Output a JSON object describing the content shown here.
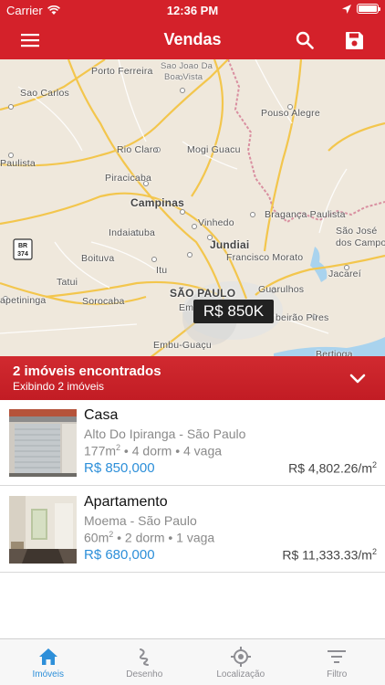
{
  "status_bar": {
    "carrier": "Carrier",
    "time": "12:36 PM",
    "battery_level": 0.9
  },
  "nav": {
    "title": "Vendas",
    "menu_icon": "hamburger-icon",
    "search_icon": "search-icon",
    "save_icon": "floppy-disk-icon"
  },
  "map": {
    "labels": {
      "porto_ferreira": "Porto Ferreira",
      "sao_joao": "Sao Joao Da",
      "boa_vista": "Boa Vista",
      "sao_carlos": "Sao Carlos",
      "pouso_alegre": "Pouso Alegre",
      "rio_claro": "Rio Claro",
      "mogi_guacu": "Mogi Guacu",
      "paulista": "Paulista",
      "piracicaba": "Piracicaba",
      "campinas": "Campinas",
      "vinhedo": "Vinhedo",
      "braganca": "Bragança Paulista",
      "sao_jose": "São José",
      "dos_campos": "dos Campo",
      "indaiatuba": "Indaiatuba",
      "jundiai": "Jundiai",
      "itu": "Itu",
      "francisco_morato": "Francisco Morato",
      "jacarei": "Jacareí",
      "tatui": "Tatui",
      "boituva": "Boituva",
      "sorocaba": "Sorocaba",
      "sao_paulo": "SÃO PAULO",
      "guarulhos": "Guarulhos",
      "apetininga": "apetininga",
      "embu": "Em",
      "ribeirao_pires": "beirão Pires",
      "embu_guacu": "Embu-Guaçu",
      "bertioga": "Bertioga",
      "shield_top": "BR",
      "shield_bottom": "374"
    },
    "price_marker": "R$ 850K"
  },
  "results": {
    "title": "2 imóveis encontrados",
    "subtitle": "Exibindo 2 imóveis",
    "chevron_icon": "chevron-down-icon"
  },
  "listings": [
    {
      "title": "Casa",
      "location": "Alto Do Ipiranga - São Paulo",
      "area": "177m",
      "area_sup": "2",
      "rooms": " • 4 dorm • 4 vaga",
      "price": "R$ 850,000",
      "price_per_sqm": "R$ 4,802.26/m",
      "price_per_sqm_sup": "2"
    },
    {
      "title": "Apartamento",
      "location": "Moema - São Paulo",
      "area": "60m",
      "area_sup": "2",
      "rooms": " • 2 dorm • 1 vaga",
      "price": "R$ 680,000",
      "price_per_sqm": "R$ 11,333.33/m",
      "price_per_sqm_sup": "2"
    }
  ],
  "tabs": [
    {
      "label": "Imóveis",
      "icon": "house-icon",
      "active": true
    },
    {
      "label": "Desenho",
      "icon": "draw-icon",
      "active": false
    },
    {
      "label": "Localização",
      "icon": "crosshair-icon",
      "active": false
    },
    {
      "label": "Filtro",
      "icon": "filter-icon",
      "active": false
    }
  ],
  "colors": {
    "brand_red": "#d4212a",
    "price_blue": "#2d8fd9",
    "tab_active": "#2d8fd9",
    "tab_inactive": "#8e8e93"
  }
}
